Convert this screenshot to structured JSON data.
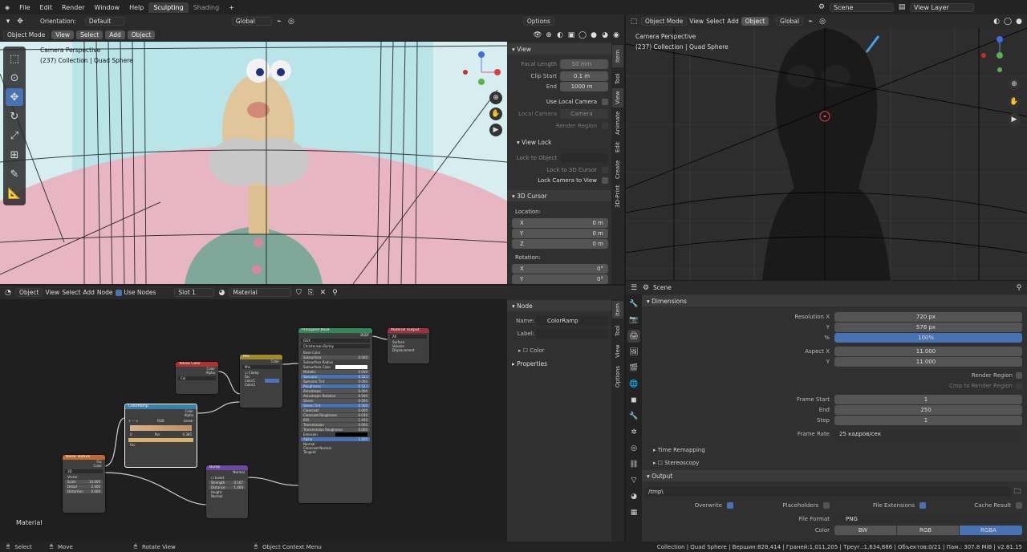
{
  "topbar": {
    "menus": [
      "File",
      "Edit",
      "Render",
      "Window",
      "Help"
    ],
    "tabs": [
      "Sculpting",
      "Shading"
    ],
    "scene": "Scene",
    "view_layer": "View Layer"
  },
  "tool_header": {
    "orientation_label": "Orientation:",
    "orientation_value": "Default",
    "transform_space": "Global",
    "options": "Options"
  },
  "viewport_left": {
    "mode": "Object Mode",
    "menus": [
      "View",
      "Select",
      "Add",
      "Object"
    ],
    "title": "Camera Perspective",
    "subtitle": "(237) Collection | Quad Sphere"
  },
  "npanel": {
    "view_section": "View",
    "focal_length_label": "Focal Length",
    "focal_length": "50 mm",
    "clip_start_label": "Clip Start",
    "clip_start": "0.1 m",
    "end_label": "End",
    "end": "1000 m",
    "use_local_camera": "Use Local Camera",
    "local_camera_label": "Local Camera",
    "local_camera_value": "Camera",
    "render_region": "Render Region",
    "view_lock_section": "View Lock",
    "lock_to_object": "Lock to Object",
    "lock_to_3d_cursor": "Lock to 3D Cursor",
    "lock_camera_to_view": "Lock Camera to View",
    "cursor_section": "3D Cursor",
    "location_label": "Location:",
    "loc_x": "X",
    "loc_x_val": "0 m",
    "loc_y": "Y",
    "loc_y_val": "0 m",
    "loc_z": "Z",
    "loc_z_val": "0 m",
    "rotation_label": "Rotation:",
    "rot_x": "X",
    "rot_x_val": "0°",
    "rot_y": "Y",
    "rot_y_val": "0°",
    "tabs": [
      "Item",
      "Tool",
      "View",
      "Animate",
      "Edit",
      "Create",
      "3D-Print"
    ]
  },
  "viewport_right": {
    "mode": "Object Mode",
    "menus": [
      "View",
      "Select",
      "Add",
      "Object"
    ],
    "transform_space": "Global",
    "title": "Camera Perspective",
    "subtitle": "(237) Collection | Quad Sphere"
  },
  "node_editor": {
    "type": "Object",
    "menus": [
      "View",
      "Select",
      "Add",
      "Node"
    ],
    "use_nodes": "Use Nodes",
    "slot": "Slot 1",
    "material": "Material",
    "corner_label": "Material"
  },
  "node_panel": {
    "section": "Node",
    "name_label": "Name:",
    "name_value": "ColorRamp",
    "label_label": "Label:",
    "color_label": "Color",
    "properties": "Properties",
    "tabs": [
      "Item",
      "Tool",
      "View",
      "Options"
    ]
  },
  "nodes": {
    "principled": "Principled BSDF",
    "material_output": "Material Output",
    "mix": "Mix",
    "yellow_color": "Yellow Color",
    "colorramp": "ColorRamp",
    "noise": "Noise Texture",
    "bump": "Bump",
    "bsdf": "BSDF",
    "ggx": "GGX",
    "christensen": "Christensen-Burley",
    "base_color": "Base Color",
    "subsurface": "Subsurface",
    "subsurface_radius": "Subsurface Radius",
    "subsurface_color": "Subsurface Color",
    "metallic": "Metallic",
    "specular": "Specular",
    "specular_tint": "Specular Tint",
    "roughness": "Roughness",
    "anisotropic": "Anisotropic",
    "aniso_rotation": "Anisotropic Rotation",
    "sheen": "Sheen",
    "sheen_tint": "Sheen Tint",
    "clearcoat": "Clearcoat",
    "clearcoat_rough": "Clearcoat Roughness",
    "ior": "IOR",
    "transmission": "Transmission",
    "transmission_rough": "Transmission Roughness",
    "emission": "Emission",
    "alpha": "Alpha",
    "normal": "Normal",
    "clearcoat_normal": "Clearcoat Normal",
    "tangent": "Tangent",
    "v0": "0.000",
    "v523": "0.523",
    "v500": "0.500",
    "v030": "0.030",
    "v1450": "1.450",
    "v1000": "1.000",
    "all": "All",
    "surface": "Surface",
    "volume": "Volume",
    "displacement": "Displacement",
    "color": "Color",
    "alpha_out": "Alpha",
    "col": "Col",
    "fac": "Fac",
    "clamp": "Clamp",
    "color1": "Color1",
    "color2": "Color2",
    "rgb": "RGB",
    "linear": "Linear",
    "pos": "Pos",
    "pos_val": "0.385",
    "zero": "0",
    "d3": "3D",
    "vector": "Vector",
    "scale": "Scale",
    "scale_val": "10.000",
    "detail": "Detail",
    "detail_val": "2.000",
    "distortion": "Distortion",
    "distortion_val": "0.000",
    "invert": "Invert",
    "strength": "Strength",
    "strength_val": "0.167",
    "distance": "Distance",
    "distance_val": "1.000",
    "height": "Height",
    "normal_out": "Normal"
  },
  "properties": {
    "scene": "Scene",
    "dimensions": "Dimensions",
    "res_x_label": "Resolution X",
    "res_x": "720 px",
    "res_y_label": "Y",
    "res_y": "576 px",
    "pct_label": "%",
    "pct": "100%",
    "aspect_x_label": "Aspect X",
    "aspect_x": "11.000",
    "aspect_y_label": "Y",
    "aspect_y": "11.000",
    "render_region": "Render Region",
    "crop": "Crop to Render Region",
    "frame_start_label": "Frame Start",
    "frame_start": "1",
    "end_label": "End",
    "end": "250",
    "step_label": "Step",
    "step": "1",
    "frame_rate_label": "Frame Rate",
    "frame_rate": "25 кадров/сек",
    "time_remapping": "Time Remapping",
    "stereoscopy": "Stereoscopy",
    "output": "Output",
    "path": "/tmp\\",
    "overwrite": "Overwrite",
    "placeholders": "Placeholders",
    "file_extensions": "File Extensions",
    "cache_result": "Cache Result",
    "file_format_label": "File Format",
    "file_format": "PNG",
    "color_label": "Color",
    "bw": "BW",
    "rgb": "RGB",
    "rgba": "RGBA"
  },
  "status": {
    "select": "Select",
    "move": "Move",
    "rotate": "Rotate View",
    "context": "Object Context Menu",
    "info": "Collection | Quad Sphere | Вершин:828,414 | Граней:1,011,205 | Треуг.:1,634,886 | Объектов:0/21 | Пам.: 307.8 MiB | v2.81.15"
  },
  "colors": {
    "accent": "#4772b3",
    "header": "#2b2b2b",
    "panel": "#303030"
  }
}
